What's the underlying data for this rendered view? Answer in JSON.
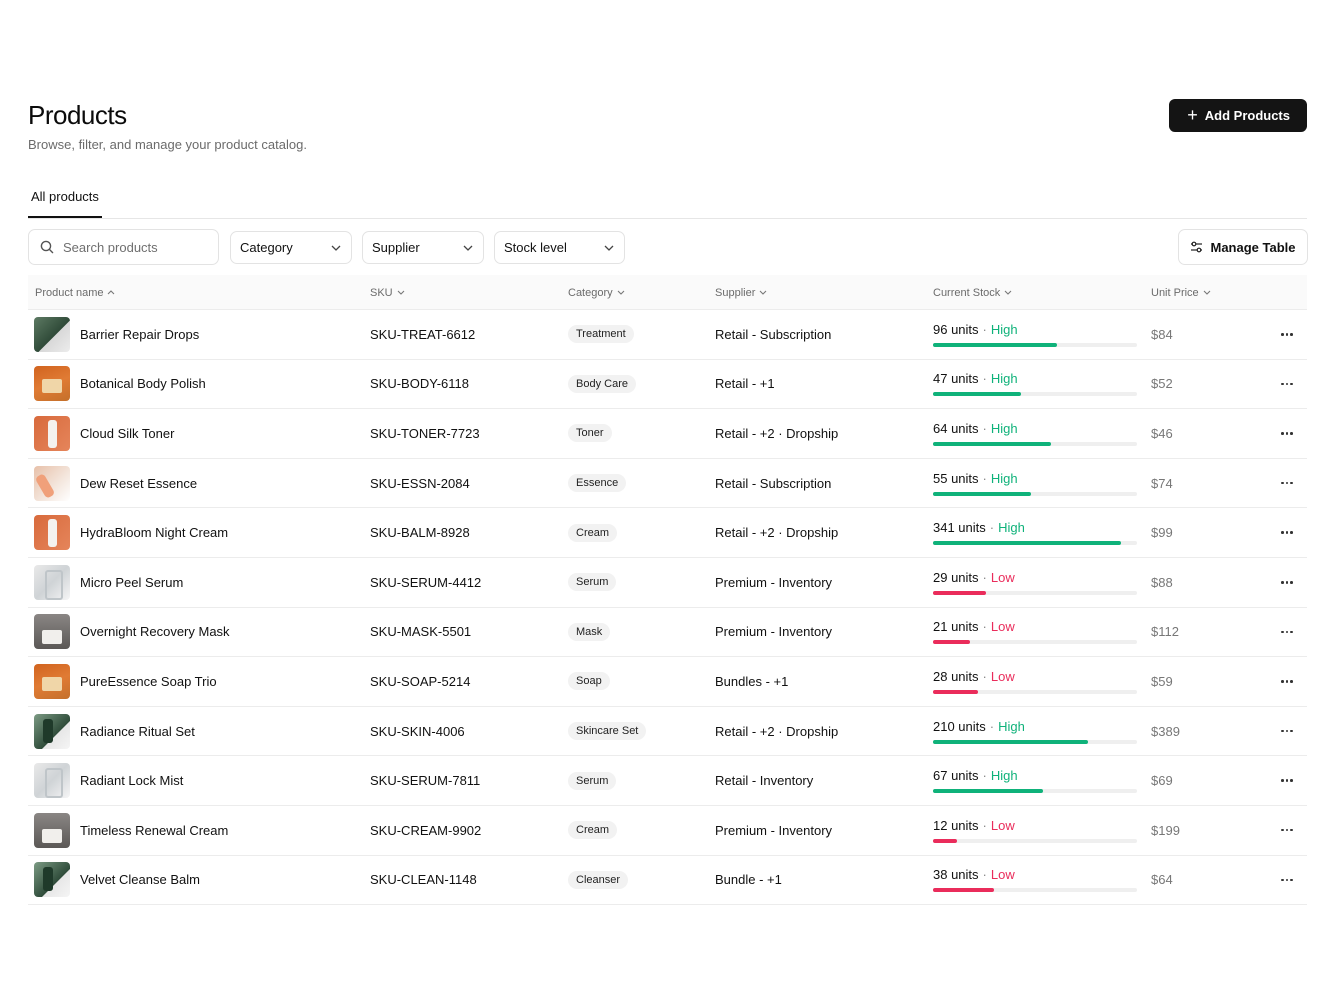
{
  "header": {
    "title": "Products",
    "subtitle": "Browse, filter, and manage your product catalog.",
    "add_button": "Add Products"
  },
  "tabs": [
    {
      "label": "All products",
      "active": true
    }
  ],
  "toolbar": {
    "search_placeholder": "Search products",
    "filters": [
      "Category",
      "Supplier",
      "Stock level"
    ],
    "manage_table": "Manage Table"
  },
  "table": {
    "columns": [
      "Product name",
      "SKU",
      "Category",
      "Supplier",
      "Current Stock",
      "Unit Price"
    ],
    "rows": [
      {
        "name": "Barrier Repair Drops",
        "sku": "SKU-TREAT-6612",
        "category": "Treatment",
        "supplier": "Retail - Subscription",
        "stock": "96 units",
        "level": "High",
        "fill": 0.61,
        "price": "$84",
        "thumb": "green"
      },
      {
        "name": "Botanical Body Polish",
        "sku": "SKU-BODY-6118",
        "category": "Body Care",
        "supplier": "Retail - +1",
        "stock": "47 units",
        "level": "High",
        "fill": 0.43,
        "price": "$52",
        "thumb": "orange"
      },
      {
        "name": "Cloud Silk Toner",
        "sku": "SKU-TONER-7723",
        "category": "Toner",
        "supplier": "Retail - +2 · Dropship",
        "stock": "64 units",
        "level": "High",
        "fill": 0.58,
        "price": "$46",
        "thumb": "red"
      },
      {
        "name": "Dew Reset Essence",
        "sku": "SKU-ESSN-2084",
        "category": "Essence",
        "supplier": "Retail - Subscription",
        "stock": "55 units",
        "level": "High",
        "fill": 0.48,
        "price": "$74",
        "thumb": "peach"
      },
      {
        "name": "HydraBloom Night Cream",
        "sku": "SKU-BALM-8928",
        "category": "Cream",
        "supplier": "Retail - +2 · Dropship",
        "stock": "341 units",
        "level": "High",
        "fill": 0.92,
        "price": "$99",
        "thumb": "red"
      },
      {
        "name": "Micro Peel Serum",
        "sku": "SKU-SERUM-4412",
        "category": "Serum",
        "supplier": "Premium - Inventory",
        "stock": "29 units",
        "level": "Low",
        "fill": 0.26,
        "price": "$88",
        "thumb": "silver"
      },
      {
        "name": "Overnight Recovery Mask",
        "sku": "SKU-MASK-5501",
        "category": "Mask",
        "supplier": "Premium - Inventory",
        "stock": "21 units",
        "level": "Low",
        "fill": 0.18,
        "price": "$112",
        "thumb": "grey"
      },
      {
        "name": "PureEssence Soap Trio",
        "sku": "SKU-SOAP-5214",
        "category": "Soap",
        "supplier": "Bundles - +1",
        "stock": "28 units",
        "level": "Low",
        "fill": 0.22,
        "price": "$59",
        "thumb": "orange"
      },
      {
        "name": "Radiance Ritual Set",
        "sku": "SKU-SKIN-4006",
        "category": "Skincare Set",
        "supplier": "Retail - +2 · Dropship",
        "stock": "210 units",
        "level": "High",
        "fill": 0.76,
        "price": "$389",
        "thumb": "greendark"
      },
      {
        "name": "Radiant Lock Mist",
        "sku": "SKU-SERUM-7811",
        "category": "Serum",
        "supplier": "Retail - Inventory",
        "stock": "67 units",
        "level": "High",
        "fill": 0.54,
        "price": "$69",
        "thumb": "silver"
      },
      {
        "name": "Timeless Renewal Cream",
        "sku": "SKU-CREAM-9902",
        "category": "Cream",
        "supplier": "Premium - Inventory",
        "stock": "12 units",
        "level": "Low",
        "fill": 0.12,
        "price": "$199",
        "thumb": "grey"
      },
      {
        "name": "Velvet Cleanse Balm",
        "sku": "SKU-CLEAN-1148",
        "category": "Cleanser",
        "supplier": "Bundle - +1",
        "stock": "38 units",
        "level": "Low",
        "fill": 0.3,
        "price": "$64",
        "thumb": "greendark"
      }
    ]
  },
  "colors": {
    "high": "#0fb27a",
    "low": "#ea2c5b",
    "primary_button": "#141414"
  }
}
